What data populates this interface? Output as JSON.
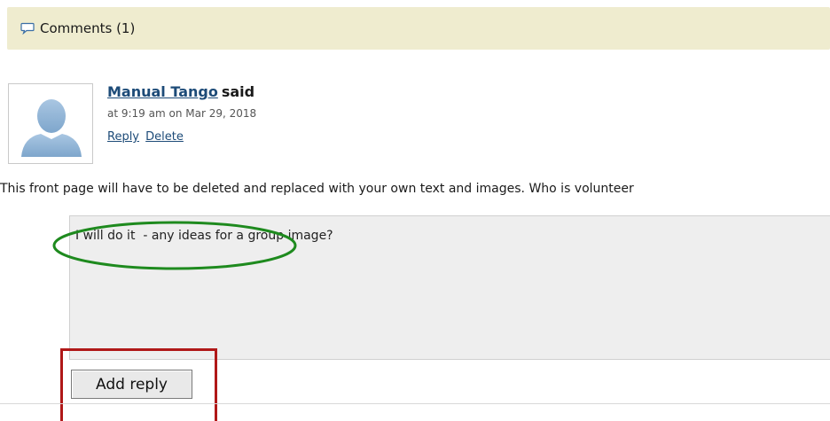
{
  "comments_header": {
    "icon": "speech-bubble-icon",
    "label": "Comments (1)"
  },
  "comment": {
    "avatar_icon": "default-user-avatar",
    "author": "Manual Tango",
    "said": "said",
    "timestamp": "at 9:19 am on Mar 29, 2018",
    "reply_label": "Reply",
    "delete_label": "Delete",
    "body": "This front page will have to be deleted and replaced with your own text and images. Who is volunteer"
  },
  "reply_form": {
    "text": "I will do it  - any ideas for a group image?",
    "submit_label": "Add reply"
  },
  "colors": {
    "header_bg": "#efeccf",
    "link": "#1d4b78",
    "annotation_green": "#1e8a1e",
    "annotation_red": "#b01818"
  }
}
